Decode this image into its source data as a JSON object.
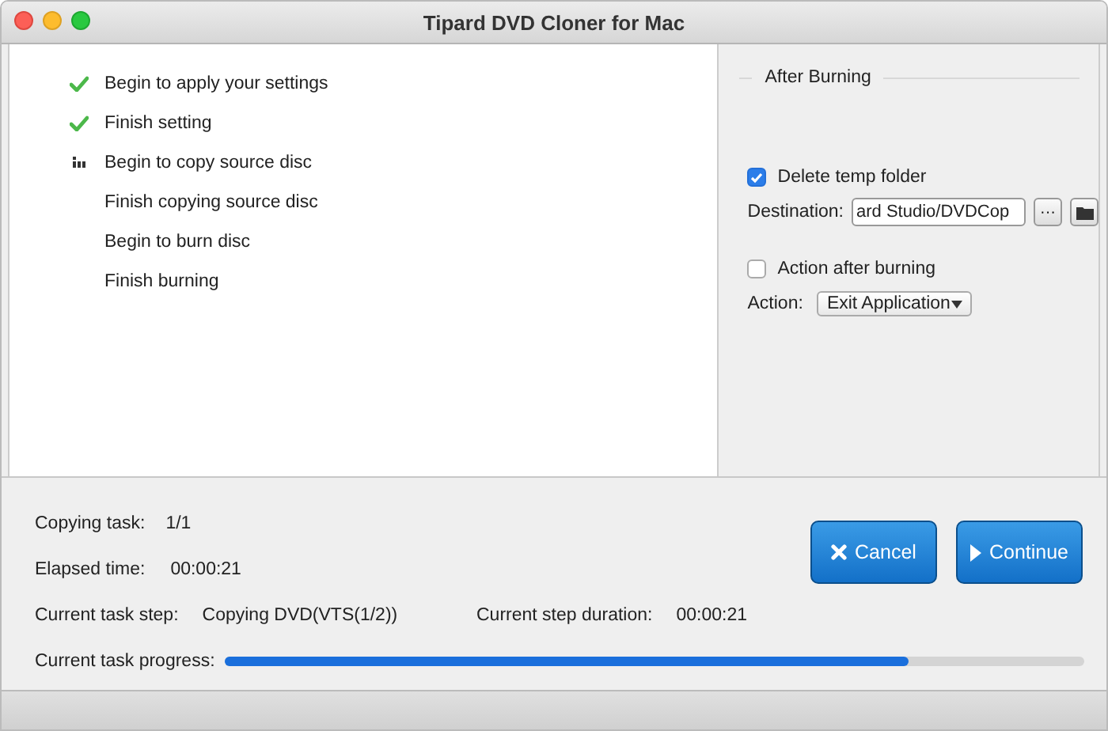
{
  "window": {
    "title": "Tipard DVD Cloner for Mac"
  },
  "steps": [
    {
      "label": "Begin to apply your settings",
      "done": true,
      "in_progress": false
    },
    {
      "label": "Finish setting",
      "done": true,
      "in_progress": false
    },
    {
      "label": "Begin to copy source disc",
      "done": false,
      "in_progress": true
    },
    {
      "label": "Finish copying source disc",
      "done": false,
      "in_progress": false
    },
    {
      "label": "Begin to burn disc",
      "done": false,
      "in_progress": false
    },
    {
      "label": "Finish burning",
      "done": false,
      "in_progress": false
    }
  ],
  "after_burning": {
    "title": "After Burning",
    "delete_temp": {
      "label": "Delete temp folder",
      "checked": true
    },
    "destination": {
      "label": "Destination:",
      "value": "ard Studio/DVDCop",
      "browse_label": "···"
    },
    "action_after": {
      "label": "Action after burning",
      "checked": false
    },
    "action": {
      "label": "Action:",
      "value": "Exit Application"
    }
  },
  "status": {
    "copying_task": {
      "label": "Copying task:",
      "value": "1/1"
    },
    "elapsed": {
      "label": "Elapsed time:",
      "value": "00:00:21"
    },
    "step": {
      "label": "Current task step:",
      "value": "Copying DVD(VTS(1/2))"
    },
    "step_duration": {
      "label": "Current step duration:",
      "value": "00:00:21"
    },
    "progress": {
      "label": "Current task progress:",
      "level": 0.795
    }
  },
  "buttons": [
    {
      "label": "Cancel",
      "kind": "cancel"
    },
    {
      "label": "Continue",
      "kind": "continue"
    }
  ]
}
